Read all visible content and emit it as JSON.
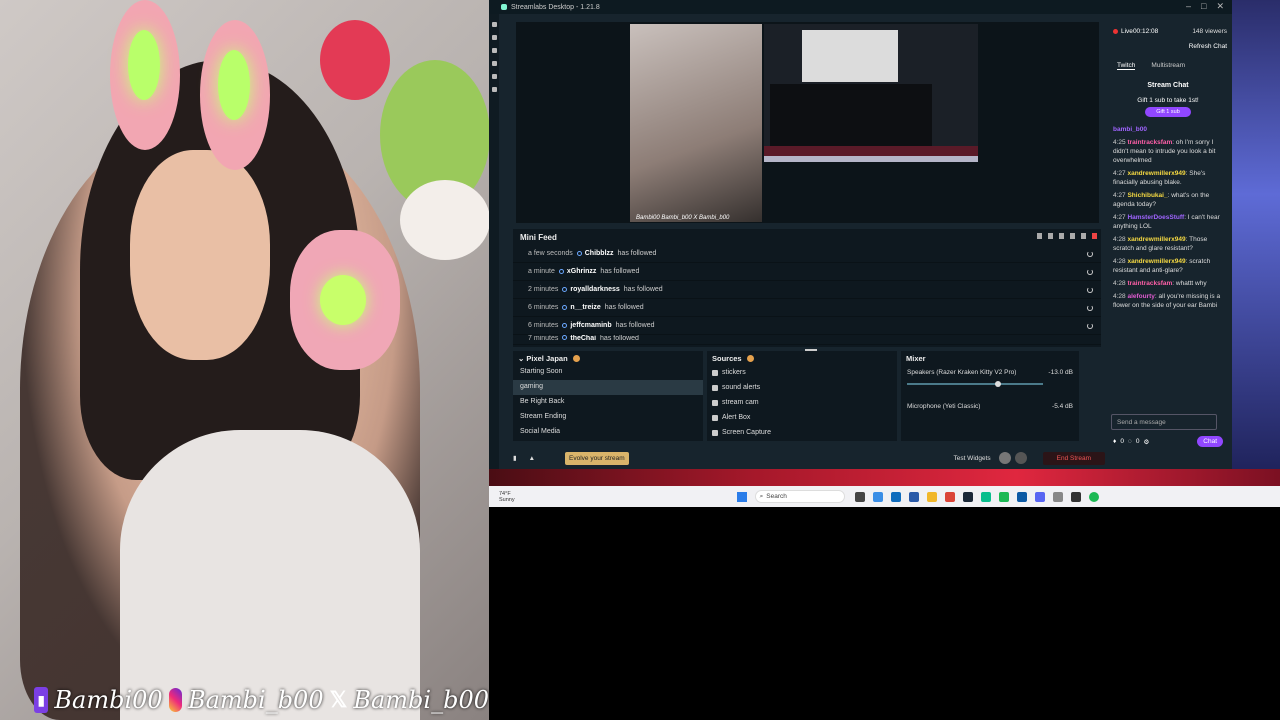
{
  "overlay": {
    "twitch": "Bambi00",
    "instagram": "Bambi_b00",
    "x": "Bambi_b00"
  },
  "app": {
    "title": "Streamlabs Desktop - 1.21.8",
    "preview_caption": "Bambi00 Bambi_b00 X Bambi_b00",
    "minifeed": {
      "title": "Mini Feed",
      "action": "has followed",
      "items": [
        {
          "time": "a few seconds",
          "user": "Chibblzz"
        },
        {
          "time": "a minute",
          "user": "xGhrinzz"
        },
        {
          "time": "2 minutes",
          "user": "royalldarkness"
        },
        {
          "time": "6 minutes",
          "user": "n__treize"
        },
        {
          "time": "6 minutes",
          "user": "jeffcmaminb"
        },
        {
          "time": "7 minutes",
          "user": "theChai"
        }
      ]
    },
    "scenes": {
      "title": "Pixel Japan",
      "items": [
        "Starting Soon",
        "gaming",
        "Be Right Back",
        "Stream Ending",
        "Social Media"
      ]
    },
    "sources": {
      "title": "Sources",
      "items": [
        "stickers",
        "sound alerts",
        "stream cam",
        "Alert Box",
        "Screen Capture"
      ]
    },
    "mixer": {
      "title": "Mixer",
      "channels": [
        {
          "name": "Speakers (Razer Kraken Kitty V2 Pro)",
          "db": "-13.0 dB"
        },
        {
          "name": "Microphone (Yeti Classic)",
          "db": "-5.4 dB"
        }
      ]
    },
    "footer": {
      "evolve": "Evolve your stream",
      "test_widgets": "Test Widgets",
      "end_stream": "End Stream"
    },
    "right": {
      "live_label": "Live",
      "live_time": "00:12:08",
      "viewers": "148 viewers",
      "refresh": "Refresh Chat",
      "tab_twitch": "Twitch",
      "tab_multi": "Multistream",
      "stream_chat": "Stream Chat",
      "gift_text": "Gift 1 sub to take 1st!",
      "gift_btn": "Gift 1 sub",
      "chat": [
        {
          "time": "",
          "name": "bambi_b00",
          "msg": ""
        },
        {
          "time": "4:25",
          "name": "traintracksfam",
          "msg": ": oh I'm sorry I didn't mean to intrude you look a bit overwhelmed"
        },
        {
          "time": "4:27",
          "name": "xandrewmillerx949",
          "msg": ": She's finacially abusing blake."
        },
        {
          "time": "4:27",
          "name": "Shichibukai_",
          "msg": ": what's on the agenda today?"
        },
        {
          "time": "4:27",
          "name": "HamsterDoesStuff",
          "msg": ": I can't hear anything LOL"
        },
        {
          "time": "4:28",
          "name": "xandrewmillerx949",
          "msg": ": Those scratch and glare resistant?"
        },
        {
          "time": "4:28",
          "name": "xandrewmillerx949",
          "msg": ": scratch resistant and anti-glare?"
        },
        {
          "time": "4:28",
          "name": "traintracksfam",
          "msg": ": whattt why"
        },
        {
          "time": "4:28",
          "name": "alefourty",
          "msg": ": all you're missing is a flower on the side of your ear Bambi"
        }
      ],
      "send_placeholder": "Send a message",
      "bits": "0",
      "points": "0",
      "chat_btn": "Chat"
    }
  },
  "taskbar": {
    "temp": "74°F",
    "cond": "Sunny",
    "search": "Search"
  }
}
